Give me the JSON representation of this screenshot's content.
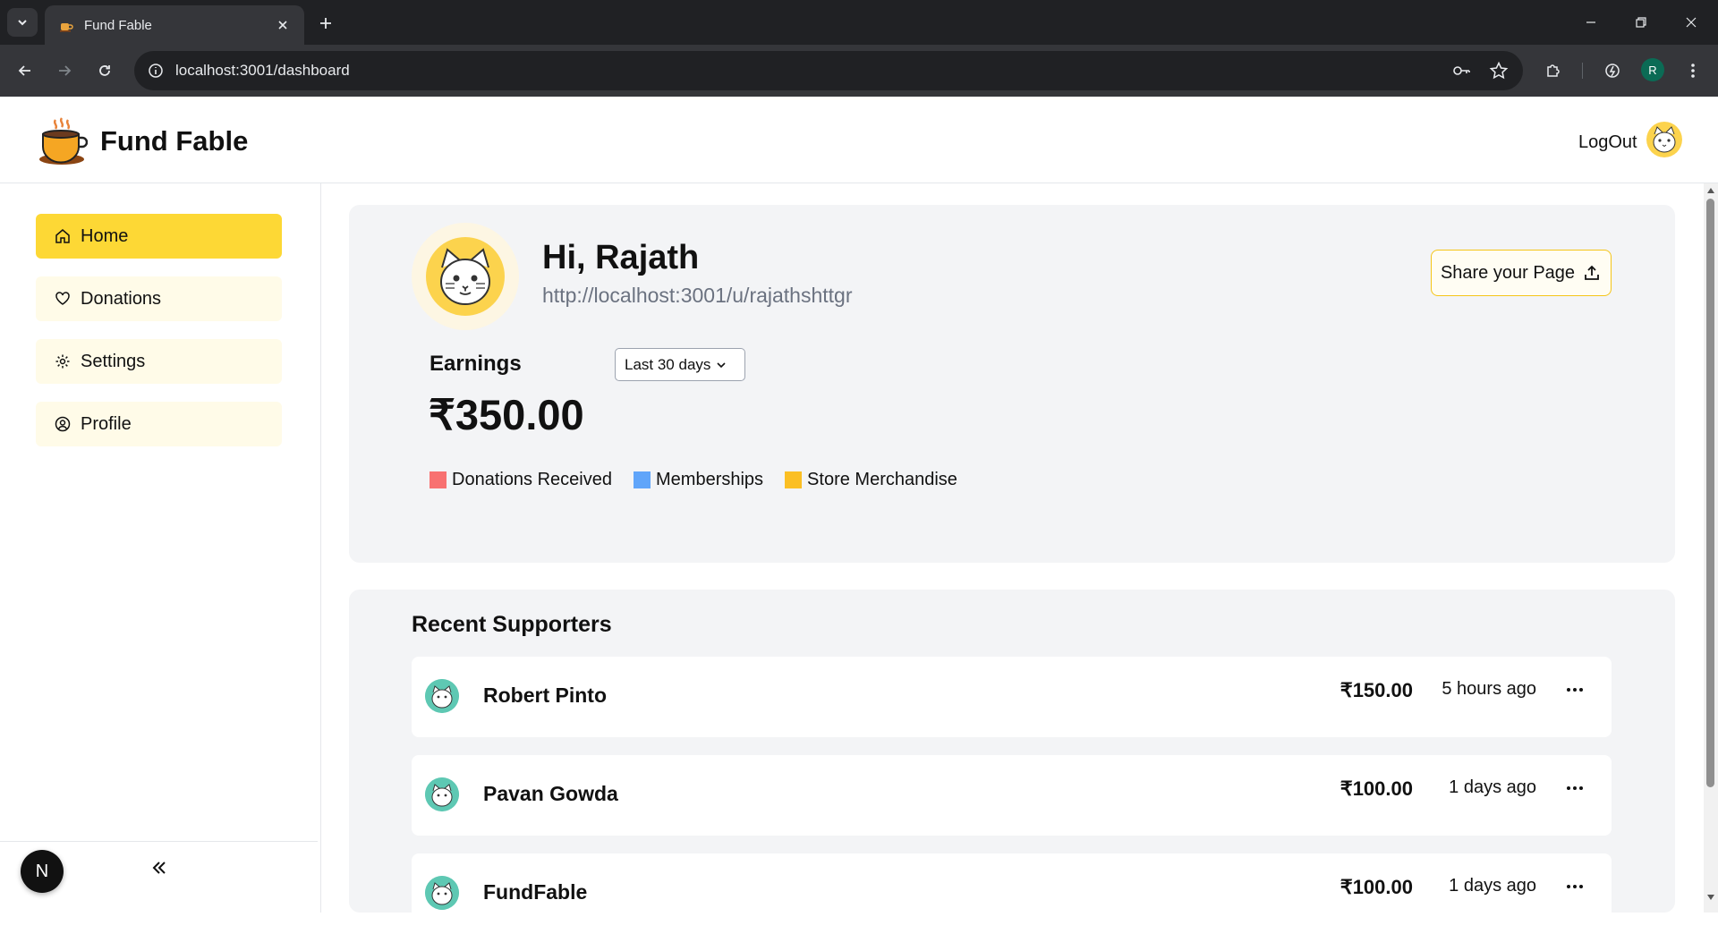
{
  "browser": {
    "tab_title": "Fund Fable",
    "url": "localhost:3001/dashboard",
    "profile_initial": "R"
  },
  "header": {
    "brand": "Fund Fable",
    "logout_label": "LogOut"
  },
  "sidebar": {
    "items": [
      {
        "label": "Home",
        "icon": "home-icon",
        "active": true
      },
      {
        "label": "Donations",
        "icon": "heart-icon",
        "active": false
      },
      {
        "label": "Settings",
        "icon": "gear-icon",
        "active": false
      },
      {
        "label": "Profile",
        "icon": "user-circle-icon",
        "active": false
      }
    ],
    "badge": "N"
  },
  "hero": {
    "greeting": "Hi, Rajath",
    "page_url": "http://localhost:3001/u/rajathshttgr",
    "share_label": "Share your Page",
    "earnings_label": "Earnings",
    "range": "Last 30 days",
    "amount": "₹350.00",
    "legend": [
      {
        "label": "Donations Received",
        "color": "#f87171"
      },
      {
        "label": "Memberships",
        "color": "#60a5fa"
      },
      {
        "label": "Store Merchandise",
        "color": "#fbbf24"
      }
    ]
  },
  "supporters": {
    "title": "Recent Supporters",
    "rows": [
      {
        "name": "Robert Pinto",
        "amount": "₹150.00",
        "time": "5 hours ago"
      },
      {
        "name": "Pavan Gowda",
        "amount": "₹100.00",
        "time": "1 days ago"
      },
      {
        "name": "FundFable",
        "amount": "₹100.00",
        "time": "1 days ago"
      }
    ]
  }
}
